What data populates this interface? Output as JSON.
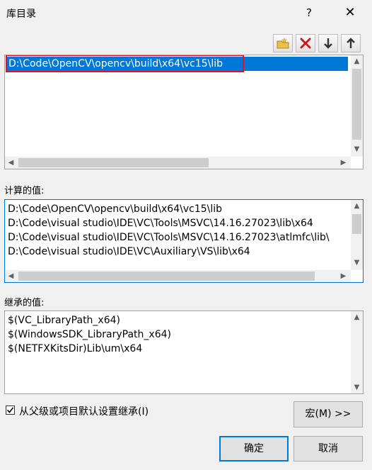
{
  "dialog": {
    "title": "库目录",
    "help_label": "?",
    "close_label": "✕"
  },
  "toolbar": {
    "new_line": "new-folder-icon",
    "delete": "delete-icon",
    "move_down": "arrow-down-icon",
    "move_up": "arrow-up-icon"
  },
  "edit_list": {
    "items": [
      "D:\\Code\\OpenCV\\opencv\\build\\x64\\vc15\\lib"
    ]
  },
  "computed": {
    "label": "计算的值:",
    "items": [
      "D:\\Code\\OpenCV\\opencv\\build\\x64\\vc15\\lib",
      "D:\\Code\\visual studio\\IDE\\VC\\Tools\\MSVC\\14.16.27023\\lib\\x64",
      "D:\\Code\\visual studio\\IDE\\VC\\Tools\\MSVC\\14.16.27023\\atlmfc\\lib\\",
      "D:\\Code\\visual studio\\IDE\\VC\\Auxiliary\\VS\\lib\\x64"
    ]
  },
  "inherited": {
    "label": "继承的值:",
    "items": [
      "$(VC_LibraryPath_x64)",
      "$(WindowsSDK_LibraryPath_x64)",
      "$(NETFXKitsDir)Lib\\um\\x64"
    ]
  },
  "inherit_checkbox": {
    "label": "从父级或项目默认设置继承(I)",
    "checked": true
  },
  "buttons": {
    "macro": "宏(M) >>",
    "ok": "确定",
    "cancel": "取消"
  },
  "colors": {
    "selection": "#0078d7",
    "highlight_box": "#e81123",
    "accent": "#0078d7"
  }
}
